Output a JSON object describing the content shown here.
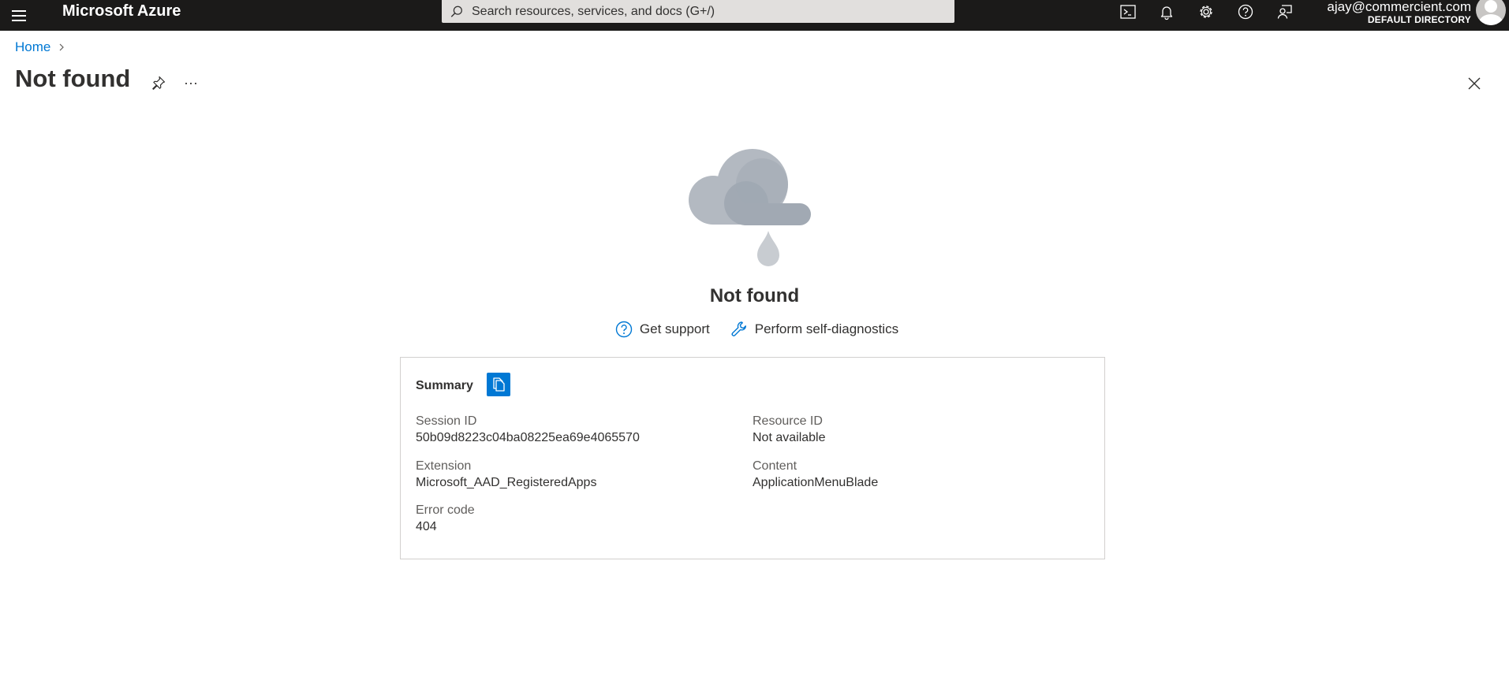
{
  "topbar": {
    "brand": "Microsoft Azure",
    "search_placeholder": "Search resources, services, and docs (G+/)",
    "account_email": "ajay@commercient.com",
    "account_directory": "DEFAULT DIRECTORY",
    "icons": [
      "cloud-shell-icon",
      "notifications-icon",
      "settings-icon",
      "help-icon",
      "feedback-icon"
    ]
  },
  "breadcrumb": {
    "home": "Home"
  },
  "page": {
    "title": "Not found",
    "more": "···"
  },
  "error": {
    "heading": "Not found",
    "get_support": "Get support",
    "self_diagnostics": "Perform self-diagnostics"
  },
  "summary": {
    "title": "Summary",
    "session_id_label": "Session ID",
    "session_id_value": "50b09d8223c04ba08225ea69e4065570",
    "resource_id_label": "Resource ID",
    "resource_id_value": "Not available",
    "extension_label": "Extension",
    "extension_value": "Microsoft_AAD_RegisteredApps",
    "content_label": "Content",
    "content_value": "ApplicationMenuBlade",
    "error_code_label": "Error code",
    "error_code_value": "404"
  },
  "colors": {
    "topbar_bg": "#1b1a19",
    "accent": "#0078d4",
    "search_bg": "#e1dfdd",
    "cloud_light": "#b3b9c1",
    "cloud_dark": "#a1a9b3"
  }
}
